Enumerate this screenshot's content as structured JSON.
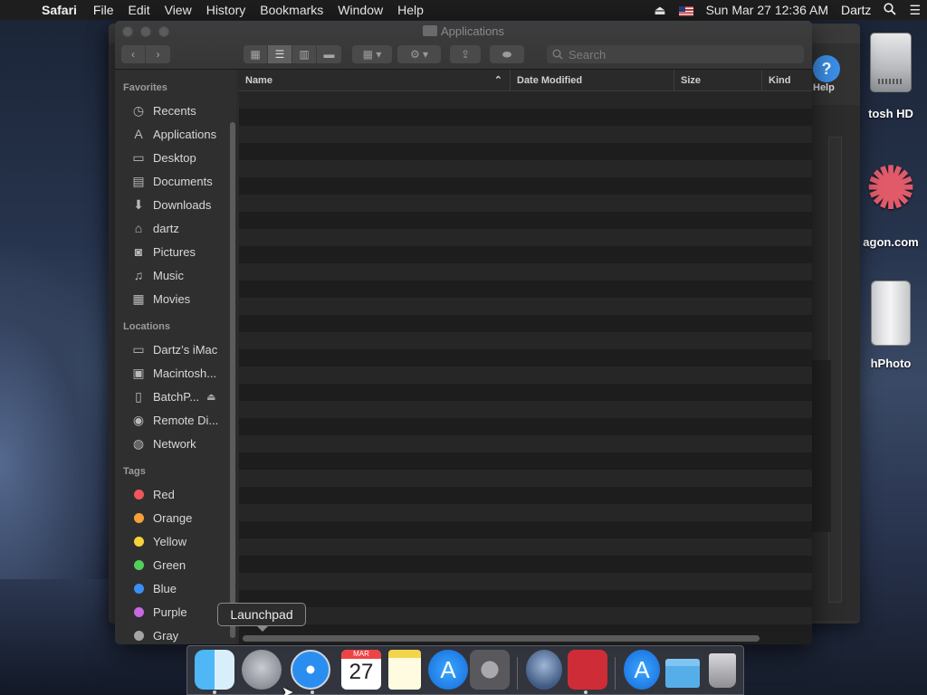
{
  "menubar": {
    "apple_icon": "apple-icon",
    "app_name": "Safari",
    "items": [
      "File",
      "Edit",
      "View",
      "History",
      "Bookmarks",
      "Window",
      "Help"
    ],
    "datetime": "Sun Mar 27  12:36 AM",
    "user": "Dartz"
  },
  "desktop": {
    "icons": [
      {
        "label": "tosh HD"
      },
      {
        "label": "agon.com"
      },
      {
        "label": "hPhoto"
      }
    ],
    "help_label": "Help"
  },
  "finder": {
    "title": "Applications",
    "search_placeholder": "Search",
    "sidebar": {
      "favorites_label": "Favorites",
      "favorites": [
        {
          "label": "Recents",
          "icon": "clock-icon"
        },
        {
          "label": "Applications",
          "icon": "applications-icon"
        },
        {
          "label": "Desktop",
          "icon": "desktop-icon"
        },
        {
          "label": "Documents",
          "icon": "document-icon"
        },
        {
          "label": "Downloads",
          "icon": "download-icon"
        },
        {
          "label": "dartz",
          "icon": "home-icon"
        },
        {
          "label": "Pictures",
          "icon": "camera-icon"
        },
        {
          "label": "Music",
          "icon": "music-icon"
        },
        {
          "label": "Movies",
          "icon": "film-icon"
        }
      ],
      "locations_label": "Locations",
      "locations": [
        {
          "label": "Dartz’s iMac",
          "icon": "computer-icon"
        },
        {
          "label": "Macintosh...",
          "icon": "disk-icon"
        },
        {
          "label": "BatchP...",
          "icon": "drive-icon"
        },
        {
          "label": "Remote Di...",
          "icon": "disc-icon"
        },
        {
          "label": "Network",
          "icon": "globe-icon"
        }
      ],
      "tags_label": "Tags",
      "tags": [
        {
          "label": "Red",
          "color": "#f0565b"
        },
        {
          "label": "Orange",
          "color": "#f6a03a"
        },
        {
          "label": "Yellow",
          "color": "#f6d23a"
        },
        {
          "label": "Green",
          "color": "#52d15a"
        },
        {
          "label": "Blue",
          "color": "#3a8ff6"
        },
        {
          "label": "Purple",
          "color": "#c66ae0"
        },
        {
          "label": "Gray",
          "color": "#a4a4a6"
        }
      ]
    },
    "columns": {
      "name": "Name",
      "date": "Date Modified",
      "size": "Size",
      "kind": "Kind"
    }
  },
  "tooltip": "Launchpad",
  "dock": {
    "calendar_month": "MAR",
    "calendar_day": "27"
  }
}
